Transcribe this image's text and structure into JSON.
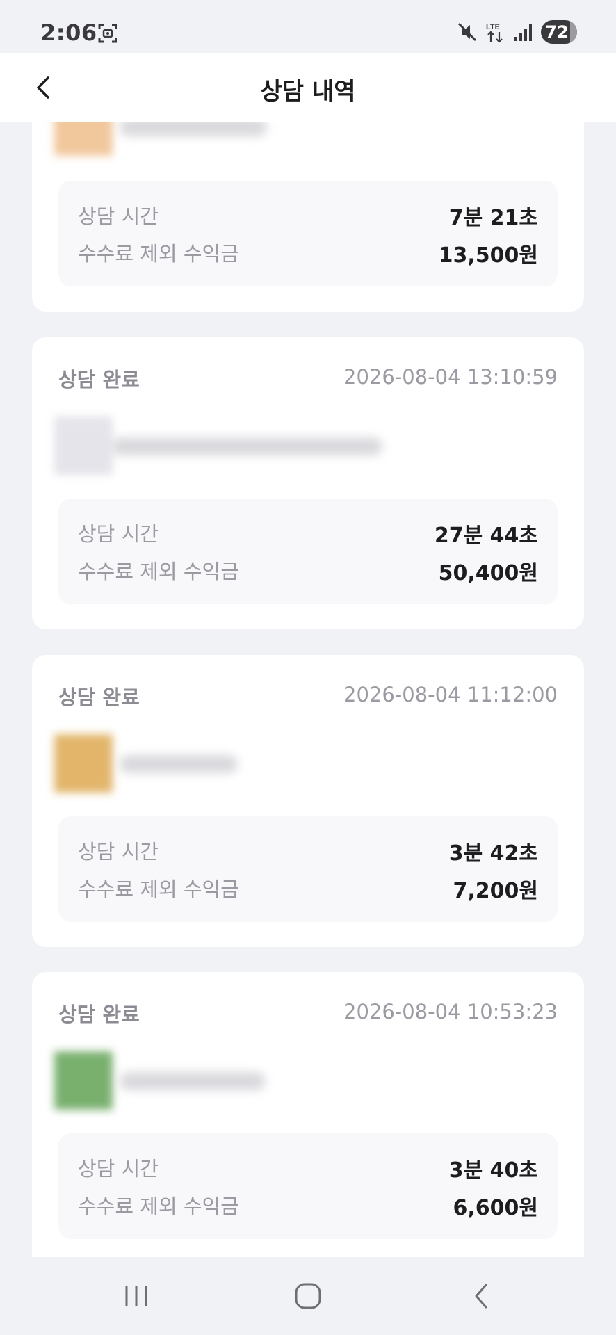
{
  "status_bar": {
    "time": "2:06",
    "battery": "72",
    "network": "LTE",
    "icons": [
      "screenshot-icon",
      "mute-icon",
      "lte-icon",
      "signal-icon",
      "battery-icon"
    ]
  },
  "header": {
    "title": "상담 내역",
    "back_icon": "chevron-left-icon"
  },
  "cards": [
    {
      "status": "",
      "timestamp": "",
      "duration_label": "상담 시간",
      "duration": "7분 21초",
      "earnings_label": "수수료 제외 수익금",
      "earnings": "13,500원",
      "avatar_color": "#f1c79c"
    },
    {
      "status": "상담 완료",
      "timestamp": "2026-08-04 13:10:59",
      "duration_label": "상담 시간",
      "duration": "27분 44초",
      "earnings_label": "수수료 제외 수익금",
      "earnings": "50,400원",
      "avatar_color": "#e4e4ea"
    },
    {
      "status": "상담 완료",
      "timestamp": "2026-08-04 11:12:00",
      "duration_label": "상담 시간",
      "duration": "3분 42초",
      "earnings_label": "수수료 제외 수익금",
      "earnings": "7,200원",
      "avatar_color": "#e2b56a"
    },
    {
      "status": "상담 완료",
      "timestamp": "2026-08-04 10:53:23",
      "duration_label": "상담 시간",
      "duration": "3분 40초",
      "earnings_label": "수수료 제외 수익금",
      "earnings": "6,600원",
      "avatar_color": "#79b06e"
    }
  ],
  "nav": {
    "icons": [
      "recent-apps-icon",
      "home-icon",
      "back-icon"
    ]
  },
  "colors": {
    "background": "#f1f2f5",
    "card": "#ffffff",
    "summary_bg": "#f8f8fa",
    "muted_text": "#9a9aa2",
    "strong_text": "#1d1d1f"
  }
}
